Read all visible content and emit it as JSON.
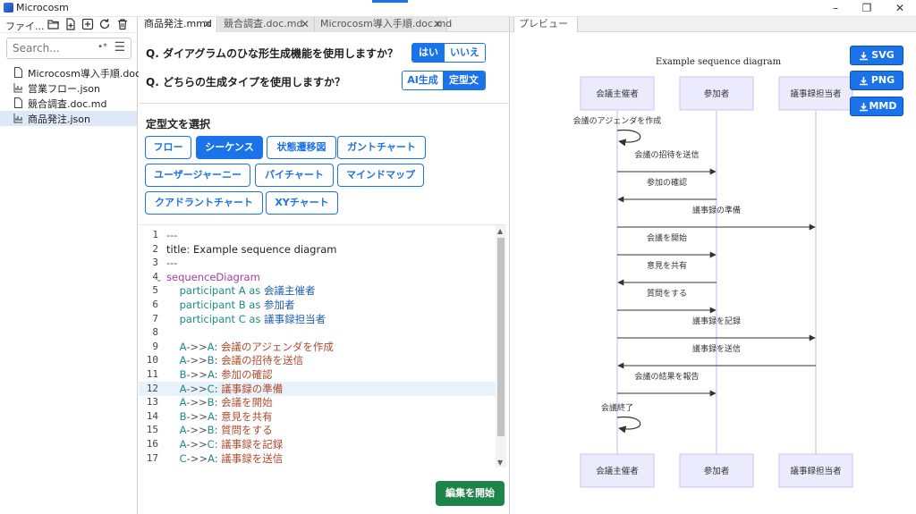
{
  "window": {
    "title": "Microcosm",
    "minimize": "–",
    "restore": "❐",
    "close": "✕"
  },
  "sidebar": {
    "toolbar_label": "ファイ...",
    "search_placeholder": "Search...",
    "regex_label": "•*",
    "menu_glyph": "☰",
    "files": [
      {
        "name": "Microcosm導入手順.doc.md",
        "icon": "file-icon",
        "selected": false
      },
      {
        "name": "営業フロー.json",
        "icon": "chart-icon",
        "selected": false
      },
      {
        "name": "競合調査.doc.md",
        "icon": "file-icon",
        "selected": false
      },
      {
        "name": "商品発注.json",
        "icon": "chart-icon",
        "selected": true
      }
    ]
  },
  "editor": {
    "tabs": [
      {
        "label": "商品発注.mmd",
        "active": true
      },
      {
        "label": "競合調査.doc.md",
        "active": false
      },
      {
        "label": "Microcosm導入手順.doc.md",
        "active": false
      }
    ],
    "tab_close": "✕",
    "q1": {
      "text": "Q. ダイアグラムのひな形生成機能を使用しますか？",
      "yes": "はい",
      "no": "いいえ"
    },
    "q2": {
      "text": "Q. どちらの生成タイプを使用しますか？",
      "ai": "AI生成",
      "template": "定型文"
    },
    "template_section_title": "定型文を選択",
    "templates": [
      "フロー",
      "シーケンス",
      "状態遷移図",
      "ガントチャート",
      "ユーザージャーニー",
      "パイチャート",
      "マインドマップ",
      "クアドラントチャート",
      "XYチャート"
    ],
    "selected_template": "シーケンス",
    "code_lines": [
      "---",
      "title: Example sequence diagram",
      "---",
      "sequenceDiagram",
      "    participant A as 会議主催者",
      "    participant B as 参加者",
      "    participant C as 議事録担当者",
      "",
      "    A->>A: 会議のアジェンダを作成",
      "    A->>B: 会議の招待を送信",
      "    B->>A: 参加の確認",
      "    A->>C: 議事録の準備",
      "    A->>B: 会議を開始",
      "    B->>A: 意見を共有",
      "    A->>B: 質問をする",
      "    A->>C: 議事録を記録",
      "    C->>A: 議事録を送信"
    ],
    "active_line": 12,
    "start_button": "編集を開始"
  },
  "preview": {
    "tab": "プレビュー",
    "export": {
      "svg": "SVG",
      "png": "PNG",
      "mmd": "MMD"
    },
    "diagram": {
      "title": "Example sequence diagram",
      "participants": [
        "会議主催者",
        "参加者",
        "議事録担当者"
      ],
      "messages": [
        {
          "from": 0,
          "to": 0,
          "text": "会議のアジェンダを作成"
        },
        {
          "from": 0,
          "to": 1,
          "text": "会議の招待を送信"
        },
        {
          "from": 1,
          "to": 0,
          "text": "参加の確認"
        },
        {
          "from": 0,
          "to": 2,
          "text": "議事録の準備"
        },
        {
          "from": 0,
          "to": 1,
          "text": "会議を開始"
        },
        {
          "from": 1,
          "to": 0,
          "text": "意見を共有"
        },
        {
          "from": 0,
          "to": 1,
          "text": "質問をする"
        },
        {
          "from": 0,
          "to": 2,
          "text": "議事録を記録"
        },
        {
          "from": 2,
          "to": 0,
          "text": "議事録を送信"
        },
        {
          "from": 0,
          "to": 1,
          "text": "会議の結果を報告"
        },
        {
          "from": 0,
          "to": 0,
          "text": "会議終了"
        }
      ]
    }
  },
  "colors": {
    "accent": "#1a73e8",
    "start": "#1e8449",
    "actor_fill": "#ecebfd",
    "actor_stroke": "#c8c5f0"
  }
}
